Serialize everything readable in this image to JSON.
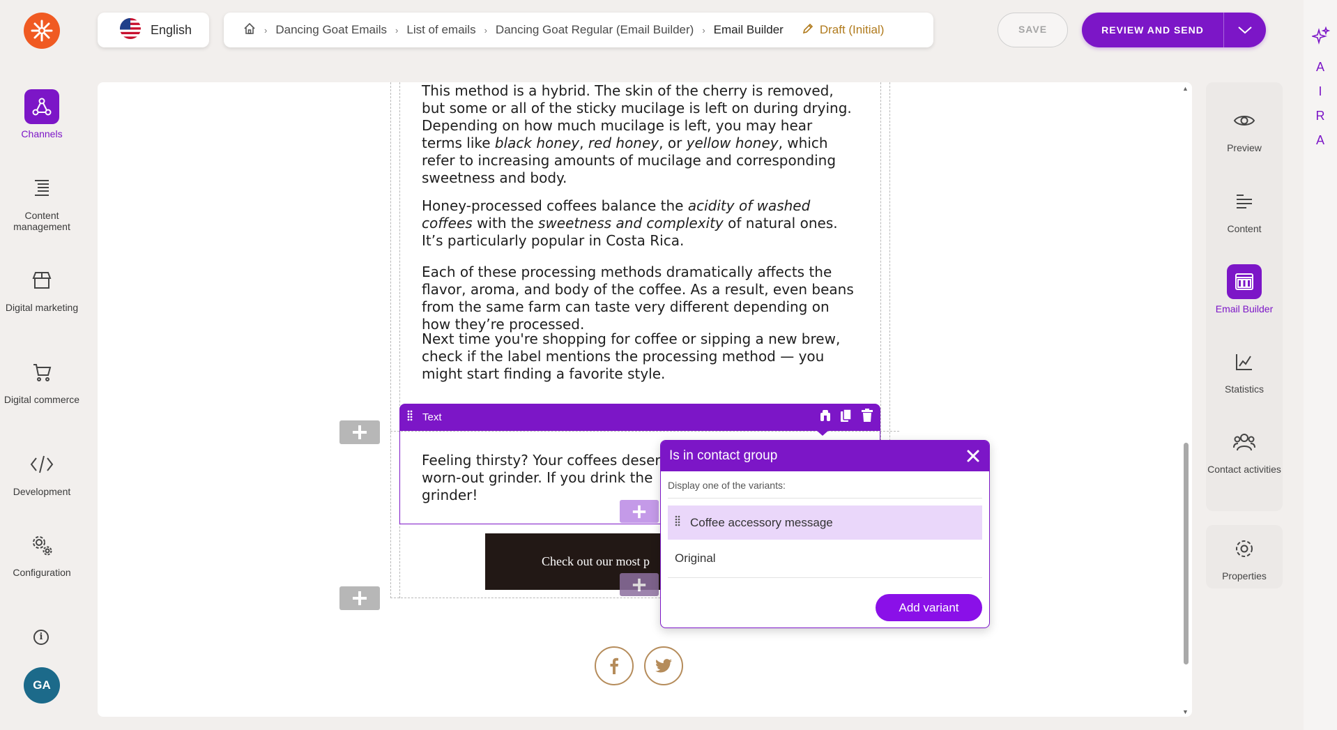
{
  "app": {
    "logo_icon": "kentico-flower-logo",
    "accent_color": "#7c16c7"
  },
  "left_nav": {
    "items": [
      {
        "label": "Channels",
        "icon": "channels-icon",
        "active": true
      },
      {
        "label": "Content management",
        "icon": "content-management-icon",
        "active": false
      },
      {
        "label": "Digital marketing",
        "icon": "digital-marketing-icon",
        "active": false
      },
      {
        "label": "Digital commerce",
        "icon": "digital-commerce-icon",
        "active": false
      },
      {
        "label": "Development",
        "icon": "development-icon",
        "active": false
      },
      {
        "label": "Configuration",
        "icon": "configuration-icon",
        "active": false
      }
    ],
    "avatar_initials": "GA"
  },
  "language": {
    "label": "English",
    "flag_icon": "us-flag-icon"
  },
  "breadcrumb": {
    "items": [
      "Dancing Goat Emails",
      "List of emails",
      "Dancing Goat Regular (Email Builder)",
      "Email Builder"
    ],
    "status": "Draft (Initial)"
  },
  "actions": {
    "save_label": "SAVE",
    "review_label": "REVIEW AND SEND"
  },
  "ai_strip": {
    "letters": [
      "A",
      "I",
      "R",
      "A"
    ]
  },
  "email": {
    "paragraph1": [
      "This method is a hybrid. The skin of the cherry is removed,",
      "but some or all of the sticky mucilage is left on during drying.",
      "Depending on how much mucilage is left, you may hear",
      "terms like ",
      "black honey",
      ", ",
      "red honey",
      ", or ",
      "yellow honey",
      ", which",
      "refer to increasing amounts of mucilage and corresponding",
      "sweetness and body."
    ],
    "paragraph2": [
      "Honey-processed coffees balance the ",
      "acidity of washed",
      "coffees",
      " with the ",
      "sweetness and complexity",
      " of natural ones.",
      "It’s particularly popular in Costa Rica."
    ],
    "paragraph3": [
      "Each of these processing methods dramatically affects the",
      "flavor, aroma, and body of the coffee. As a result, even beans",
      "from the same farm can taste very different depending on",
      "how they’re processed."
    ],
    "paragraph4": [
      "Next time you're shopping for coffee or sipping a new brew,",
      "check if the label mentions the processing method — you",
      "might start finding a favorite style."
    ],
    "selected_block_lines": [
      "Feeling thirsty? Your coffees deser",
      "worn-out grinder. If you drink the",
      "grinder!"
    ],
    "cta_label": "Check out our most p",
    "social_icons": [
      "facebook-icon",
      "twitter-icon"
    ]
  },
  "text_toolbar": {
    "title": "Text",
    "icons": [
      "personalize-icon",
      "copy-icon",
      "delete-icon"
    ]
  },
  "variant_popup": {
    "title": "Is in contact group",
    "subtitle": "Display one of the variants:",
    "variants": [
      {
        "label": "Coffee accessory message",
        "selected": true
      },
      {
        "label": "Original",
        "selected": false
      }
    ],
    "add_variant_label": "Add variant"
  },
  "right_panel": {
    "items": [
      {
        "label": "Preview",
        "icon": "eye-icon",
        "active": false
      },
      {
        "label": "Content",
        "icon": "align-left-icon",
        "active": false
      },
      {
        "label": "Email Builder",
        "icon": "email-builder-icon",
        "active": true
      },
      {
        "label": "Statistics",
        "icon": "chart-icon",
        "active": false
      },
      {
        "label": "Contact activities",
        "icon": "people-icon",
        "active": false
      }
    ],
    "properties_label": "Properties"
  }
}
